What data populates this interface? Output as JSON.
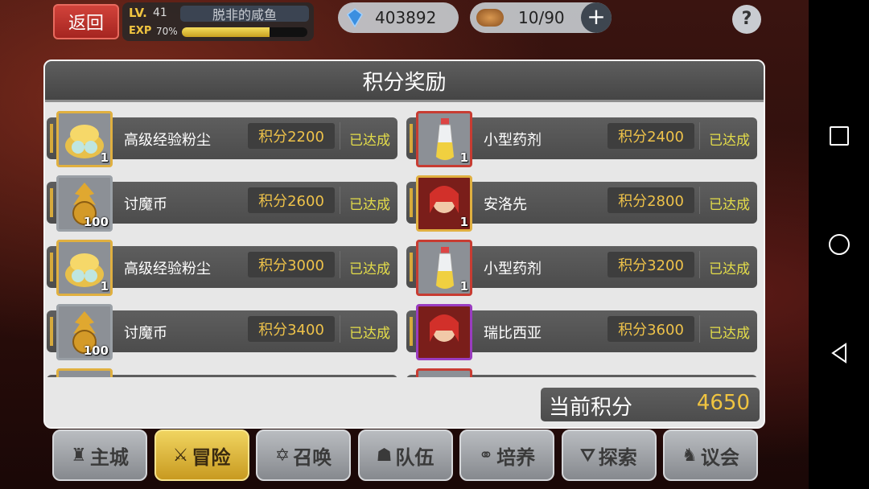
{
  "hud": {
    "back_label": "返回",
    "lv_label": "LV.",
    "level": "41",
    "player_name": "脱非的咸鱼",
    "exp_label": "EXP",
    "exp_percent_text": "70%",
    "exp_fraction": 0.7,
    "gems": "403892",
    "stamina": "10/90",
    "plus_label": "+",
    "help_label": "?"
  },
  "dialog": {
    "title": "积分奖励",
    "items": [
      {
        "name": "高级经验粉尘",
        "score": "积分2200",
        "status": "已达成",
        "qty": "1",
        "icon": "exp-dust-icon",
        "frame": "gold"
      },
      {
        "name": "小型药剂",
        "score": "积分2400",
        "status": "已达成",
        "qty": "1",
        "icon": "potion-icon",
        "frame": "red"
      },
      {
        "name": "讨魔币",
        "score": "积分2600",
        "status": "已达成",
        "qty": "100",
        "icon": "demon-coin-icon",
        "frame": "grey"
      },
      {
        "name": "安洛先",
        "score": "积分2800",
        "status": "已达成",
        "qty": "1",
        "icon": "character-portrait-icon",
        "frame": "gold"
      },
      {
        "name": "高级经验粉尘",
        "score": "积分3000",
        "status": "已达成",
        "qty": "1",
        "icon": "exp-dust-icon",
        "frame": "gold"
      },
      {
        "name": "小型药剂",
        "score": "积分3200",
        "status": "已达成",
        "qty": "1",
        "icon": "potion-icon",
        "frame": "red"
      },
      {
        "name": "讨魔币",
        "score": "积分3400",
        "status": "已达成",
        "qty": "100",
        "icon": "demon-coin-icon",
        "frame": "grey"
      },
      {
        "name": "瑞比西亚",
        "score": "积分3600",
        "status": "已达成",
        "qty": "",
        "icon": "character-portrait-icon",
        "frame": "purple"
      }
    ],
    "current_score_label": "当前积分",
    "current_score": "4650"
  },
  "tabs": [
    {
      "label": "主城",
      "icon": "castle-icon",
      "active": false
    },
    {
      "label": "冒险",
      "icon": "crossed-swords-icon",
      "active": true
    },
    {
      "label": "召唤",
      "icon": "hexagram-icon",
      "active": false
    },
    {
      "label": "队伍",
      "icon": "helmet-icon",
      "active": false
    },
    {
      "label": "培养",
      "icon": "orbs-icon",
      "active": false
    },
    {
      "label": "探索",
      "icon": "compass-icon",
      "active": false
    },
    {
      "label": "议会",
      "icon": "dragon-icon",
      "active": false
    }
  ]
}
